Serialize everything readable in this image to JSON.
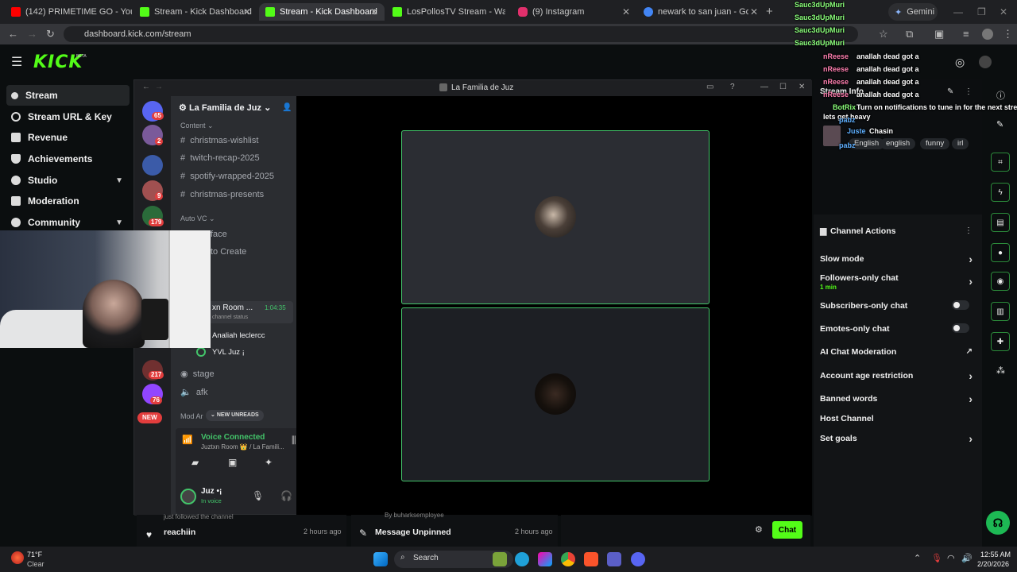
{
  "browser": {
    "tabs": [
      {
        "label": "(142) PRIMETIME GO - YouTube",
        "color": "#ff0000"
      },
      {
        "label": "Stream - Kick Dashboard",
        "color": "#53fc18"
      },
      {
        "label": "Stream - Kick Dashboard",
        "color": "#53fc18"
      },
      {
        "label": "LosPollosTV Stream - Watch Li",
        "color": "#53fc18"
      },
      {
        "label": "(9) Instagram",
        "color": "#e1306c"
      },
      {
        "label": "newark to san juan - Google Se",
        "color": "#4285f4"
      }
    ],
    "gemini_label": "Gemini",
    "url": "dashboard.kick.com/stream"
  },
  "kick": {
    "logo": "KICK",
    "logo_badge": "BETA",
    "sidebar": [
      {
        "label": "Stream"
      },
      {
        "label": "Stream URL & Key"
      },
      {
        "label": "Revenue"
      },
      {
        "label": "Achievements"
      },
      {
        "label": "Studio"
      },
      {
        "label": "Moderation"
      },
      {
        "label": "Community"
      }
    ],
    "stream_info_label": "Stream Info",
    "tags": [
      "English",
      "english",
      "funny",
      "irl"
    ],
    "channel_actions": {
      "title": "Channel Actions",
      "items": [
        {
          "label": "Slow mode"
        },
        {
          "label": "Followers-only chat",
          "sub": "1 min"
        },
        {
          "label": "Subscribers-only chat"
        },
        {
          "label": "Emotes-only chat"
        },
        {
          "label": "AI Chat Moderation"
        },
        {
          "label": "Account age restriction"
        },
        {
          "label": "Banned words"
        },
        {
          "label": "Host Channel"
        },
        {
          "label": "Set goals"
        }
      ]
    },
    "feed": [
      {
        "user": "reachiin",
        "time": "2 hours ago",
        "sub": "just followed the channel"
      },
      {
        "user": "Message Unpinned",
        "time": "2 hours ago",
        "sub": "By buharksemployee"
      }
    ],
    "chat_button": "Chat"
  },
  "overlay_chat": [
    {
      "user": "Sauc3dUpMuri",
      "text": ""
    },
    {
      "user": "Sauc3dUpMuri",
      "text": ""
    },
    {
      "user": "Sauc3dUpMuri",
      "text": ""
    },
    {
      "user": "Sauc3dUpMuri",
      "text": ""
    },
    {
      "user": "nReese",
      "text": "anallah dead got a"
    },
    {
      "user": "nReese",
      "text": "anallah dead got a"
    },
    {
      "user": "nReese",
      "text": "anallah dead got a"
    },
    {
      "user": "nReese",
      "text": "anallah dead got a"
    },
    {
      "user": "BotRix",
      "text": "Turn on notifications to tune in for the next stream!"
    },
    {
      "user": "",
      "text": "lets get heavy"
    },
    {
      "user": "pabz",
      "text": ""
    },
    {
      "user": "Juste",
      "text": "Chasin"
    },
    {
      "user": "pabz",
      "text": ""
    }
  ],
  "discord": {
    "window_title": "La Familia de Juz",
    "server_name": "La Familia de Juz",
    "server_badges": [
      "65",
      "2",
      "9",
      "179",
      "217",
      "76"
    ],
    "new_label": "NEW",
    "categories": [
      "Content",
      "Auto VC",
      "Mod Ar"
    ],
    "channels": [
      "christmas-wishlist",
      "twitch-recap-2025",
      "spotify-wrapped-2025",
      "christmas-presents"
    ],
    "voice_channels": [
      "face",
      "to Create"
    ],
    "voice_room": {
      "name": "xn Room ...",
      "timer": "1:04:35",
      "status": "channel status"
    },
    "voice_members": [
      "Analiah leclercc",
      "YVL Juz ¡"
    ],
    "other_channels": [
      "stage",
      "afk"
    ],
    "new_unreads": "NEW UNREADS",
    "voice_connected": "Voice Connected",
    "voice_location": "Juztxn Room 👑 / La Famili...",
    "user_name": "Juz •¡",
    "user_status": "In voice"
  },
  "taskbar": {
    "weather_temp": "71°F",
    "weather_cond": "Clear",
    "search_label": "Search",
    "time": "12:55 AM",
    "date": "2/20/2026"
  }
}
